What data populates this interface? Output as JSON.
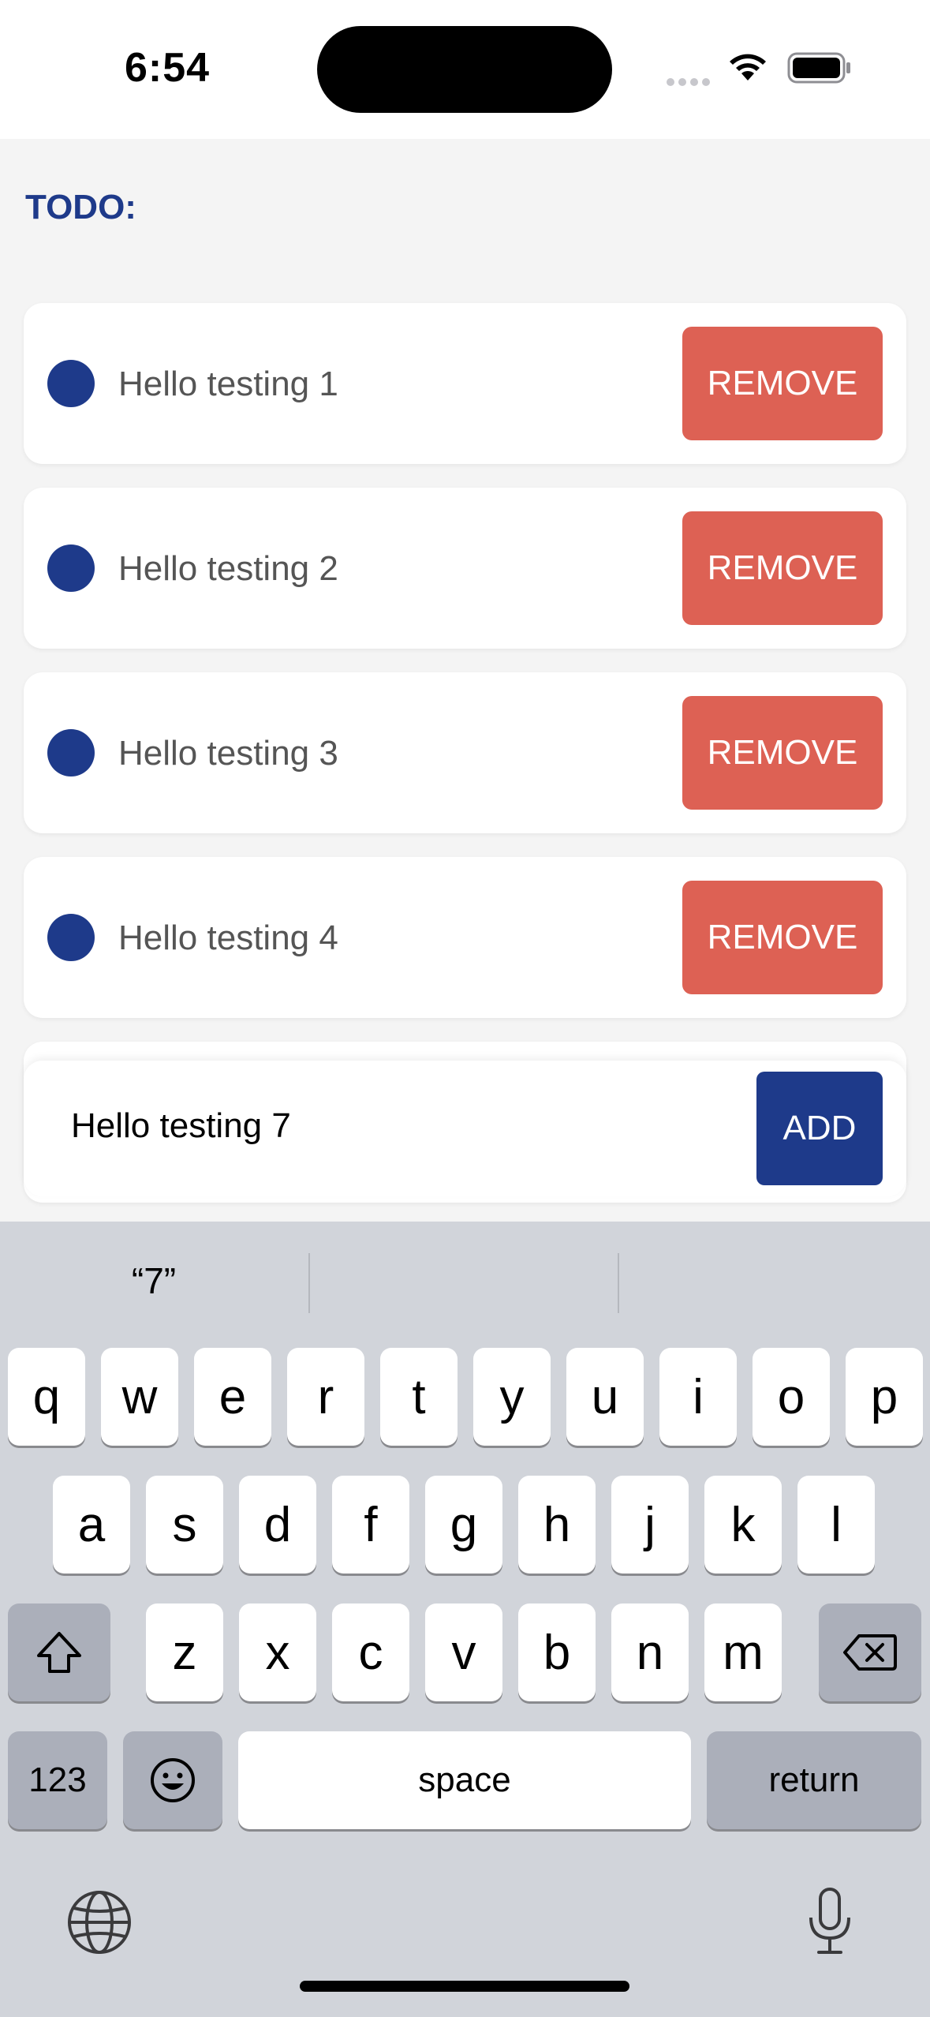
{
  "status": {
    "time": "6:54"
  },
  "header": {
    "title": "TODO:"
  },
  "todos": [
    {
      "text": "Hello testing 1",
      "action": "REMOVE"
    },
    {
      "text": "Hello testing 2",
      "action": "REMOVE"
    },
    {
      "text": "Hello testing 3",
      "action": "REMOVE"
    },
    {
      "text": "Hello testing 4",
      "action": "REMOVE"
    }
  ],
  "add_form": {
    "input_value": "Hello testing 7",
    "button_label": "ADD"
  },
  "keyboard": {
    "suggestions": [
      "“7”",
      "",
      ""
    ],
    "row1": [
      "q",
      "w",
      "e",
      "r",
      "t",
      "y",
      "u",
      "i",
      "o",
      "p"
    ],
    "row2": [
      "a",
      "s",
      "d",
      "f",
      "g",
      "h",
      "j",
      "k",
      "l"
    ],
    "row3": [
      "z",
      "x",
      "c",
      "v",
      "b",
      "n",
      "m"
    ],
    "numbers_label": "123",
    "space_label": "space",
    "return_label": "return"
  },
  "colors": {
    "accent": "#1e3a8a",
    "remove": "#dd6154",
    "background": "#f4f4f4"
  },
  "icons": [
    "wifi-icon",
    "battery-icon",
    "shift-icon",
    "delete-icon",
    "emoji-icon",
    "globe-icon",
    "microphone-icon"
  ]
}
